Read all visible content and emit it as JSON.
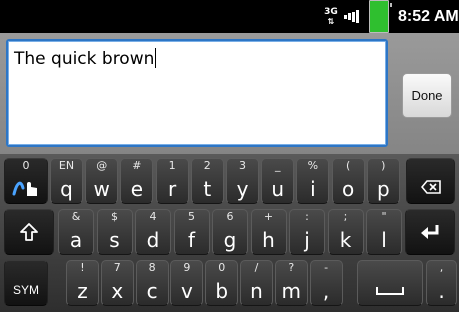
{
  "status_bar": {
    "network": "3G",
    "time": "8:52 AM",
    "icons": [
      "3g-data-icon",
      "signal-strength-icon",
      "battery-icon"
    ]
  },
  "editor": {
    "text": "The quick brown",
    "done_label": "Done"
  },
  "keyboard": {
    "row1": [
      {
        "main": "q",
        "alt": "EN"
      },
      {
        "main": "w",
        "alt": "@"
      },
      {
        "main": "e",
        "alt": "#"
      },
      {
        "main": "r",
        "alt": "1"
      },
      {
        "main": "t",
        "alt": "2"
      },
      {
        "main": "y",
        "alt": "3"
      },
      {
        "main": "u",
        "alt": "_"
      },
      {
        "main": "i",
        "alt": "%"
      },
      {
        "main": "o",
        "alt": "("
      },
      {
        "main": "p",
        "alt": ")"
      }
    ],
    "row2": [
      {
        "main": "a",
        "alt": "&"
      },
      {
        "main": "s",
        "alt": "$"
      },
      {
        "main": "d",
        "alt": "4"
      },
      {
        "main": "f",
        "alt": "5"
      },
      {
        "main": "g",
        "alt": "6"
      },
      {
        "main": "h",
        "alt": "+"
      },
      {
        "main": "j",
        "alt": ":"
      },
      {
        "main": "k",
        "alt": ";"
      },
      {
        "main": "l",
        "alt": "\""
      }
    ],
    "row3": [
      {
        "main": "z",
        "alt": "!"
      },
      {
        "main": "x",
        "alt": "7"
      },
      {
        "main": "c",
        "alt": "8"
      },
      {
        "main": "v",
        "alt": "9"
      },
      {
        "main": "b",
        "alt": "0"
      },
      {
        "main": "n",
        "alt": "/"
      },
      {
        "main": "m",
        "alt": "?"
      },
      {
        "main": ",",
        "alt": "-"
      }
    ],
    "swype_alt": "0",
    "sym_label": "SYM",
    "period_main": ".",
    "period_alt": ","
  }
}
